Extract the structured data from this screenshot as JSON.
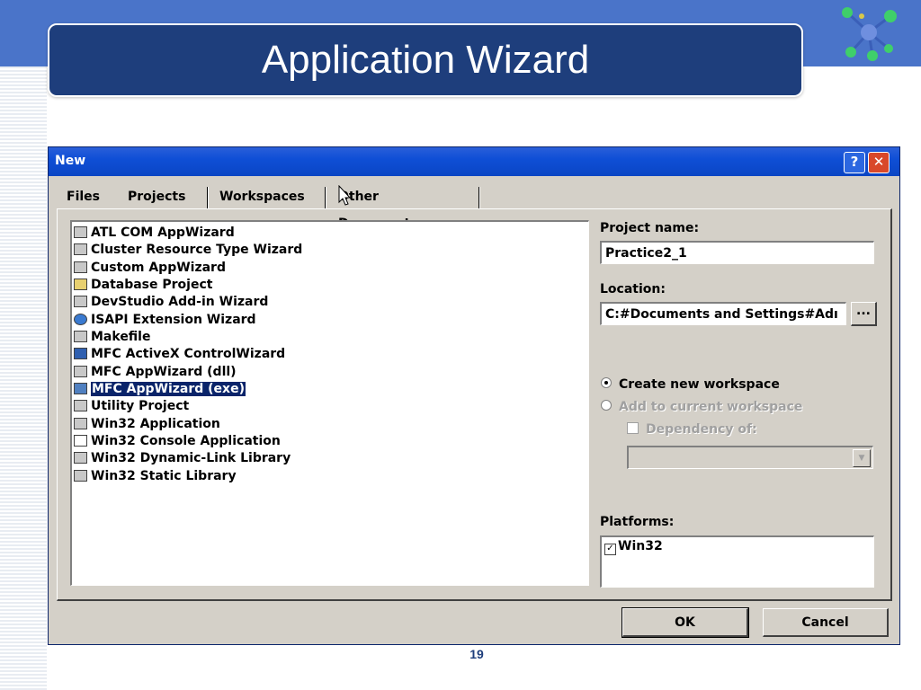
{
  "slide": {
    "title": "Application Wizard",
    "page_number": "19"
  },
  "colors": {
    "slide_band": "#4a74c9",
    "title_box": "#1e3e7c",
    "dialog_bg": "#d4d0c8",
    "titlebar": "#0a45c4",
    "selection": "#0a246a"
  },
  "dialog": {
    "title": "New",
    "help_button": "?",
    "close_button": "✕",
    "tabs": [
      {
        "label": "Files",
        "active": false
      },
      {
        "label": "Projects",
        "active": true
      },
      {
        "label": "Workspaces",
        "active": false
      },
      {
        "label": "Other Documents",
        "active": false
      }
    ],
    "project_types": [
      {
        "label": "ATL COM AppWizard",
        "icon": "atl-icon"
      },
      {
        "label": "Cluster Resource Type Wizard",
        "icon": "cluster-icon"
      },
      {
        "label": "Custom AppWizard",
        "icon": "custom-wizard-icon"
      },
      {
        "label": "Database Project",
        "icon": "database-icon"
      },
      {
        "label": "DevStudio Add-in Wizard",
        "icon": "addin-icon"
      },
      {
        "label": "ISAPI Extension Wizard",
        "icon": "globe-icon"
      },
      {
        "label": "Makefile",
        "icon": "makefile-icon"
      },
      {
        "label": "MFC ActiveX ControlWizard",
        "icon": "activex-icon"
      },
      {
        "label": "MFC AppWizard (dll)",
        "icon": "mfc-dll-icon"
      },
      {
        "label": "MFC AppWizard (exe)",
        "icon": "mfc-exe-icon",
        "selected": true
      },
      {
        "label": "Utility Project",
        "icon": "utility-icon"
      },
      {
        "label": "Win32 Application",
        "icon": "win32-app-icon"
      },
      {
        "label": "Win32 Console Application",
        "icon": "console-icon"
      },
      {
        "label": "Win32 Dynamic-Link Library",
        "icon": "dll-icon"
      },
      {
        "label": "Win32 Static Library",
        "icon": "lib-icon"
      }
    ],
    "project_name_label": "Project name:",
    "project_name_value": "Practice2_1",
    "location_label": "Location:",
    "location_value": "C:#Documents and Settings#Adı",
    "browse_label": "...",
    "create_new_workspace": "Create new workspace",
    "add_to_current_workspace": "Add to current workspace",
    "dependency_of": "Dependency of:",
    "platforms_label": "Platforms:",
    "platforms": [
      {
        "label": "Win32",
        "checked": true
      }
    ],
    "ok_label": "OK",
    "cancel_label": "Cancel"
  }
}
